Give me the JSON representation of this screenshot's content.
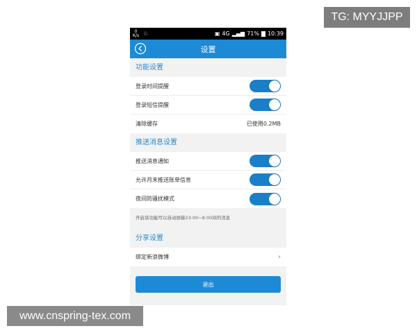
{
  "watermarks": {
    "top_right": "TG: MYYJJPP",
    "bottom_left": "www.cnspring-tex.com"
  },
  "statusbar": {
    "speed_value": "0",
    "speed_unit": "K/s",
    "network": "4G",
    "battery": "71%",
    "time": "10:39"
  },
  "appbar": {
    "title": "设置",
    "back_icon": "back-circle-icon"
  },
  "sections": [
    {
      "title": "功能设置",
      "rows": [
        {
          "label": "登录时间提醒",
          "control": "toggle",
          "on": true
        },
        {
          "label": "登录短信提醒",
          "control": "toggle",
          "on": true
        },
        {
          "label": "清除缓存",
          "control": "value",
          "value": "已使用0.2MB"
        }
      ]
    },
    {
      "title": "推送消息设置",
      "rows": [
        {
          "label": "推送消息通知",
          "control": "toggle",
          "on": true
        },
        {
          "label": "允许月末推送账单信息",
          "control": "toggle",
          "on": true
        },
        {
          "label": "夜间防骚扰模式",
          "control": "toggle",
          "on": true
        }
      ],
      "note": "开启该功能可以自动屏蔽23:00~8:00间的消息"
    },
    {
      "title": "分享设置",
      "rows": [
        {
          "label": "绑定新浪微博",
          "control": "chevron"
        }
      ]
    }
  ],
  "logout_label": "退出",
  "colors": {
    "accent": "#1d8ad6",
    "toggle_on": "#1a7fc9",
    "section_title": "#2a8ad0",
    "background": "#f2f2f2"
  }
}
